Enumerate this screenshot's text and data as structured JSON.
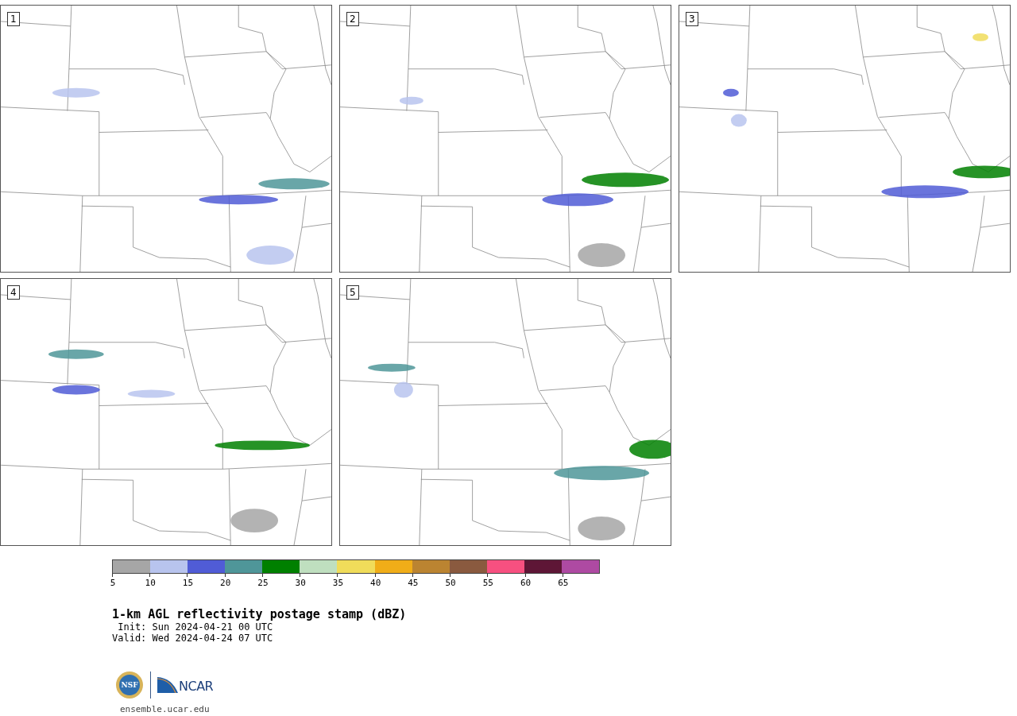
{
  "panels": [
    {
      "label": "1"
    },
    {
      "label": "2"
    },
    {
      "label": "3"
    },
    {
      "label": "4"
    },
    {
      "label": "5"
    }
  ],
  "colorbar": {
    "bins": [
      {
        "label": "5",
        "color": "#a6a6a6"
      },
      {
        "label": "10",
        "color": "#b8c4ee"
      },
      {
        "label": "15",
        "color": "#505cd6"
      },
      {
        "label": "20",
        "color": "#4f9699"
      },
      {
        "label": "25",
        "color": "#008000"
      },
      {
        "label": "30",
        "color": "#bfdfbf"
      },
      {
        "label": "35",
        "color": "#f0dc5a"
      },
      {
        "label": "40",
        "color": "#f0ad18"
      },
      {
        "label": "45",
        "color": "#bb8431"
      },
      {
        "label": "50",
        "color": "#8a5a3f"
      },
      {
        "label": "55",
        "color": "#f75080"
      },
      {
        "label": "60",
        "color": "#5e1636"
      },
      {
        "label": "65",
        "color": "#ae4aa2"
      }
    ]
  },
  "title": "1-km AGL reflectivity postage stamp (dBZ)",
  "init": " Init: Sun 2024-04-21 00 UTC",
  "valid": "Valid: Wed 2024-04-24 07 UTC",
  "logos": {
    "nsf": "NSF",
    "ncar": "NCAR"
  },
  "url": "ensemble.ucar.edu"
}
